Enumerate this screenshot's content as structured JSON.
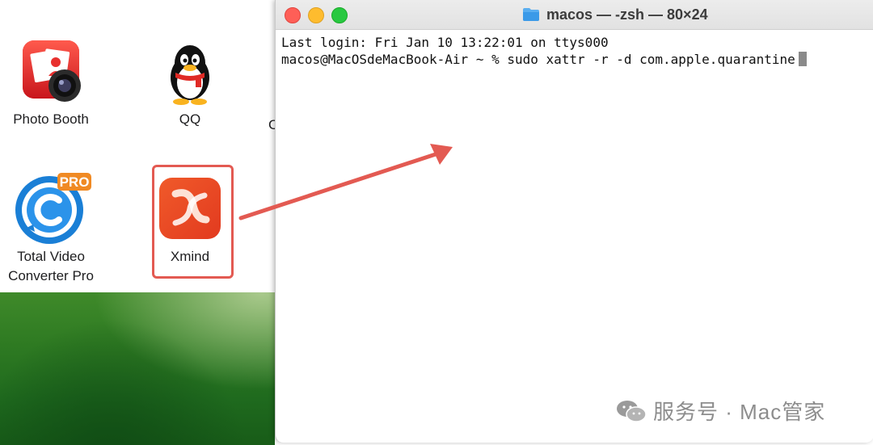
{
  "apps": [
    {
      "label": "Photo Booth"
    },
    {
      "label": "QQ"
    },
    {
      "label_line1": "Total Video",
      "label_line2": "Converter Pro"
    },
    {
      "label": "Xmind"
    }
  ],
  "cutoff_label": "C",
  "terminal": {
    "title": "macos — -zsh — 80×24",
    "line1": "Last login: Fri Jan 10 13:22:01 on ttys000",
    "line2": "macos@MacOSdeMacBook-Air ~ % sudo xattr -r -d com.apple.quarantine"
  },
  "watermark": "服务号 · Mac管家",
  "colors": {
    "highlight": "#e35a52",
    "traffic_red": "#fe5f57",
    "traffic_yellow": "#febc2e",
    "traffic_green": "#28c840"
  },
  "icons": [
    "photo-booth-icon",
    "qq-penguin-icon",
    "total-video-converter-icon",
    "xmind-icon",
    "folder-icon",
    "wechat-icon",
    "arrow-icon"
  ]
}
